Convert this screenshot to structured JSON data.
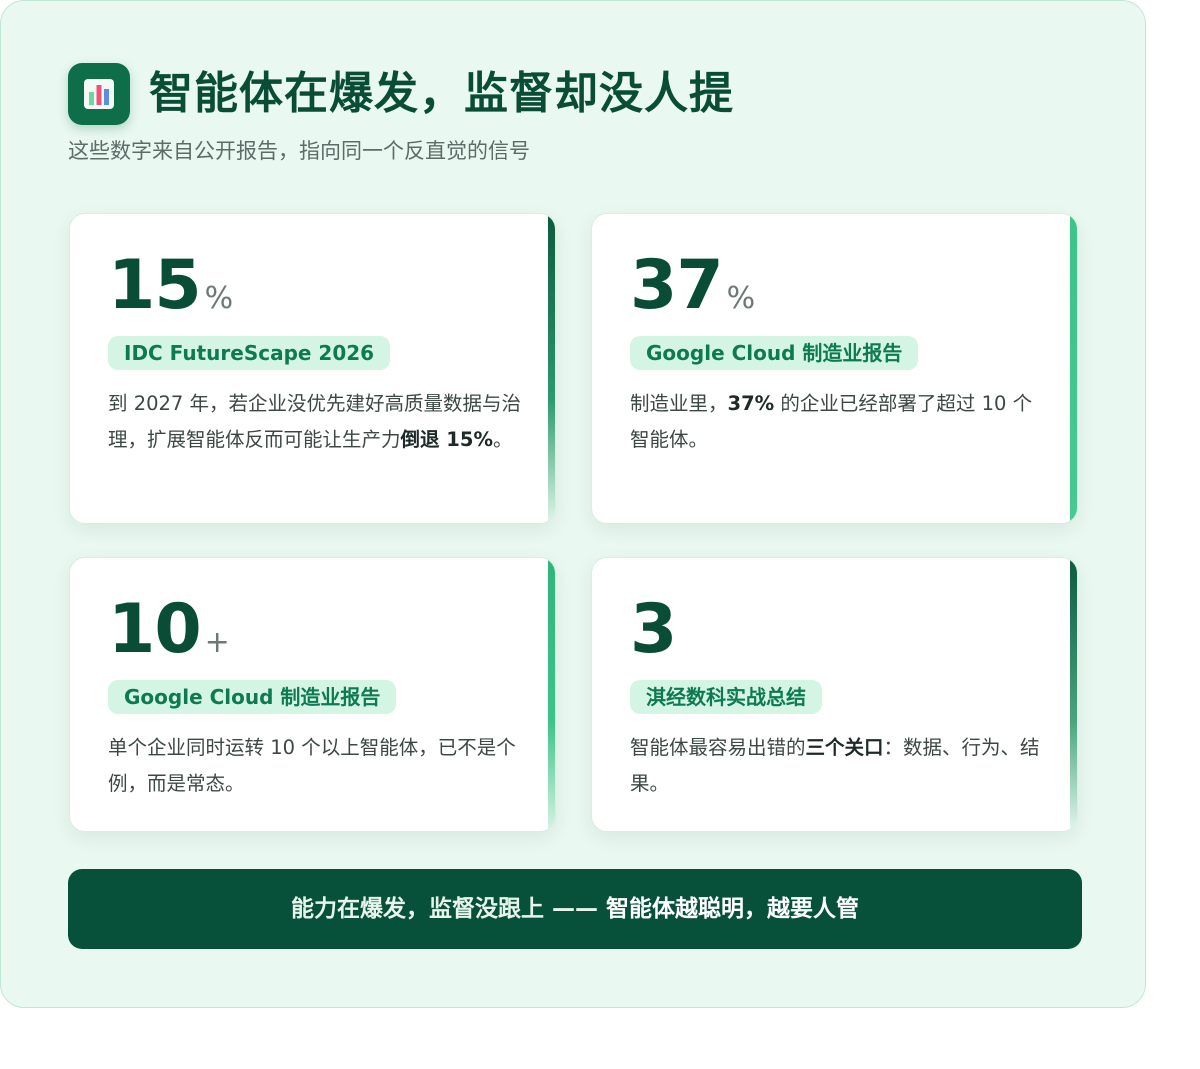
{
  "header": {
    "icon": "bar-chart-icon",
    "title": "智能体在爆发，监督却没人提",
    "subtitle": "这些数字来自公开报告，指向同一个反直觉的信号"
  },
  "cards": [
    {
      "value": "15",
      "unit": "%",
      "source": "IDC FutureScape 2026",
      "desc_pre": "到 2027 年，若企业没优先建好高质量数据与治理，扩展智能体反而可能让生产力",
      "desc_bold": "倒退 15%",
      "desc_post": "。"
    },
    {
      "value": "37",
      "unit": "%",
      "source": "Google Cloud 制造业报告",
      "desc_pre": "制造业里，",
      "desc_bold": "37%",
      "desc_post": " 的企业已经部署了超过 10 个智能体。"
    },
    {
      "value": "10",
      "unit": "+",
      "source": "Google Cloud 制造业报告",
      "desc_pre": "单个企业同时运转 10 个以上智能体，已不是个例，而是常态。",
      "desc_bold": "",
      "desc_post": ""
    },
    {
      "value": "3",
      "unit": "",
      "source": "淇经数科实战总结",
      "desc_pre": "智能体最容易出错的",
      "desc_bold": "三个关口",
      "desc_post": "：数据、行为、结果。"
    }
  ],
  "banner": {
    "text_pre": "能力在爆发，监督没跟上 —— ",
    "text_strong": "智能体越聪明，越要人管"
  }
}
